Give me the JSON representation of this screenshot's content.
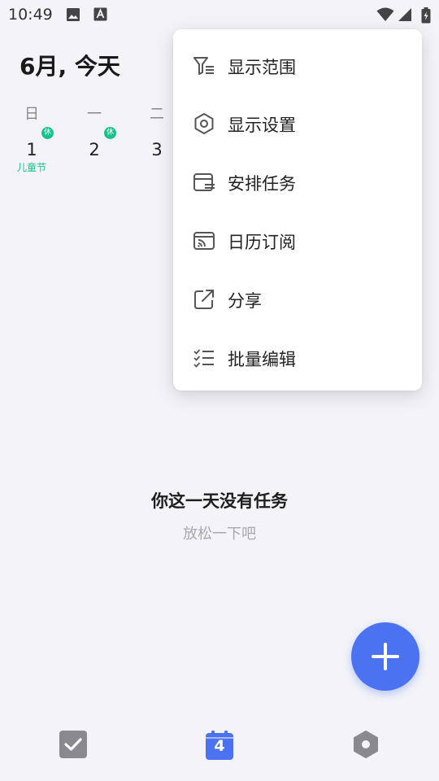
{
  "status_bar": {
    "time": "10:49"
  },
  "header": {
    "title": "6月, 今天"
  },
  "week": {
    "days": [
      {
        "weekday": "日",
        "date": "1",
        "badge": "休",
        "holiday": "儿童节"
      },
      {
        "weekday": "一",
        "date": "2",
        "badge": "休"
      },
      {
        "weekday": "二",
        "date": "3"
      }
    ]
  },
  "empty_state": {
    "title": "你这一天没有任务",
    "subtitle": "放松一下吧"
  },
  "menu": {
    "items": [
      {
        "label": "显示范围",
        "icon": "filter-icon"
      },
      {
        "label": "显示设置",
        "icon": "settings-hex-icon"
      },
      {
        "label": "安排任务",
        "icon": "arrange-task-icon"
      },
      {
        "label": "日历订阅",
        "icon": "calendar-subscribe-icon"
      },
      {
        "label": "分享",
        "icon": "share-icon"
      },
      {
        "label": "批量编辑",
        "icon": "batch-edit-icon"
      }
    ]
  },
  "bottom_nav": {
    "calendar_badge": "4",
    "items": [
      "tasks-icon",
      "calendar-icon",
      "settings-icon"
    ]
  },
  "colors": {
    "accent": "#4a72f1",
    "holiday": "#17c389",
    "background": "#f3f3f8"
  }
}
